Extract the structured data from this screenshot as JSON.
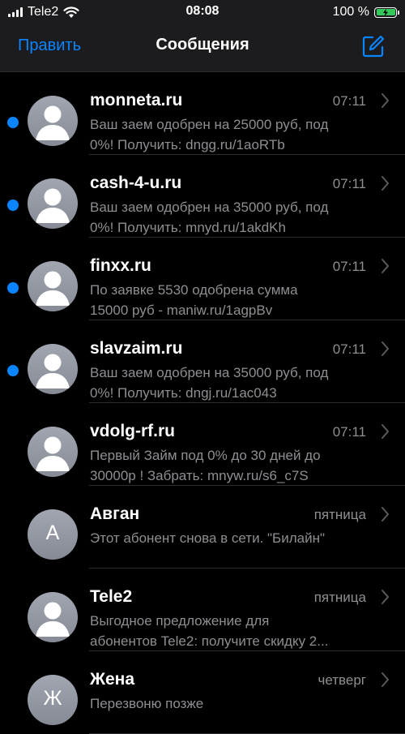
{
  "status": {
    "carrier": "Tele2",
    "time": "08:08",
    "battery": "100 %",
    "battery_level": 1.0
  },
  "nav": {
    "edit_label": "Править",
    "title": "Сообщения"
  },
  "messages": [
    {
      "sender": "monneta.ru",
      "time": "07:11",
      "line1": "Ваш заем одобрен на 25000 руб, под",
      "line2": "0%! Получить: dngg.ru/1aoRTb",
      "unread": true,
      "avatar": "person"
    },
    {
      "sender": "cash-4-u.ru",
      "time": "07:11",
      "line1": "Ваш заем одобрен на 35000 руб, под",
      "line2": "0%! Получить: mnyd.ru/1akdKh",
      "unread": true,
      "avatar": "person"
    },
    {
      "sender": "finxx.ru",
      "time": "07:11",
      "line1": "По заявке 5530 одобрена сумма",
      "line2": "15000 руб - maniw.ru/1agpBv",
      "unread": true,
      "avatar": "person"
    },
    {
      "sender": "slavzaim.ru",
      "time": "07:11",
      "line1": "Ваш заем одобрен на 35000 руб, под",
      "line2": "0%! Получить: dngj.ru/1ac043",
      "unread": true,
      "avatar": "person"
    },
    {
      "sender": "vdolg-rf.ru",
      "time": "07:11",
      "line1": "Первый Займ под 0% до 30 дней до",
      "line2": "30000р ! Забрать: mnyw.ru/s6_c7S",
      "unread": false,
      "avatar": "person"
    },
    {
      "sender": "Авган",
      "time": "пятница",
      "line1": "Этот абонент снова в сети. \"Билайн\"",
      "line2": "",
      "unread": false,
      "avatar": "letter",
      "letter": "А"
    },
    {
      "sender": "Tele2",
      "time": "пятница",
      "line1": "Выгодное предложение для",
      "line2": "абонентов Tele2: получите скидку 2...",
      "unread": false,
      "avatar": "person"
    },
    {
      "sender": "Жена",
      "time": "четверг",
      "line1": "Перезвоню позже",
      "line2": "",
      "unread": false,
      "avatar": "letter",
      "letter": "Ж"
    }
  ],
  "colors": {
    "accent": "#0a84ff",
    "battery": "#34c759",
    "secondary_text": "#8e8e93"
  }
}
